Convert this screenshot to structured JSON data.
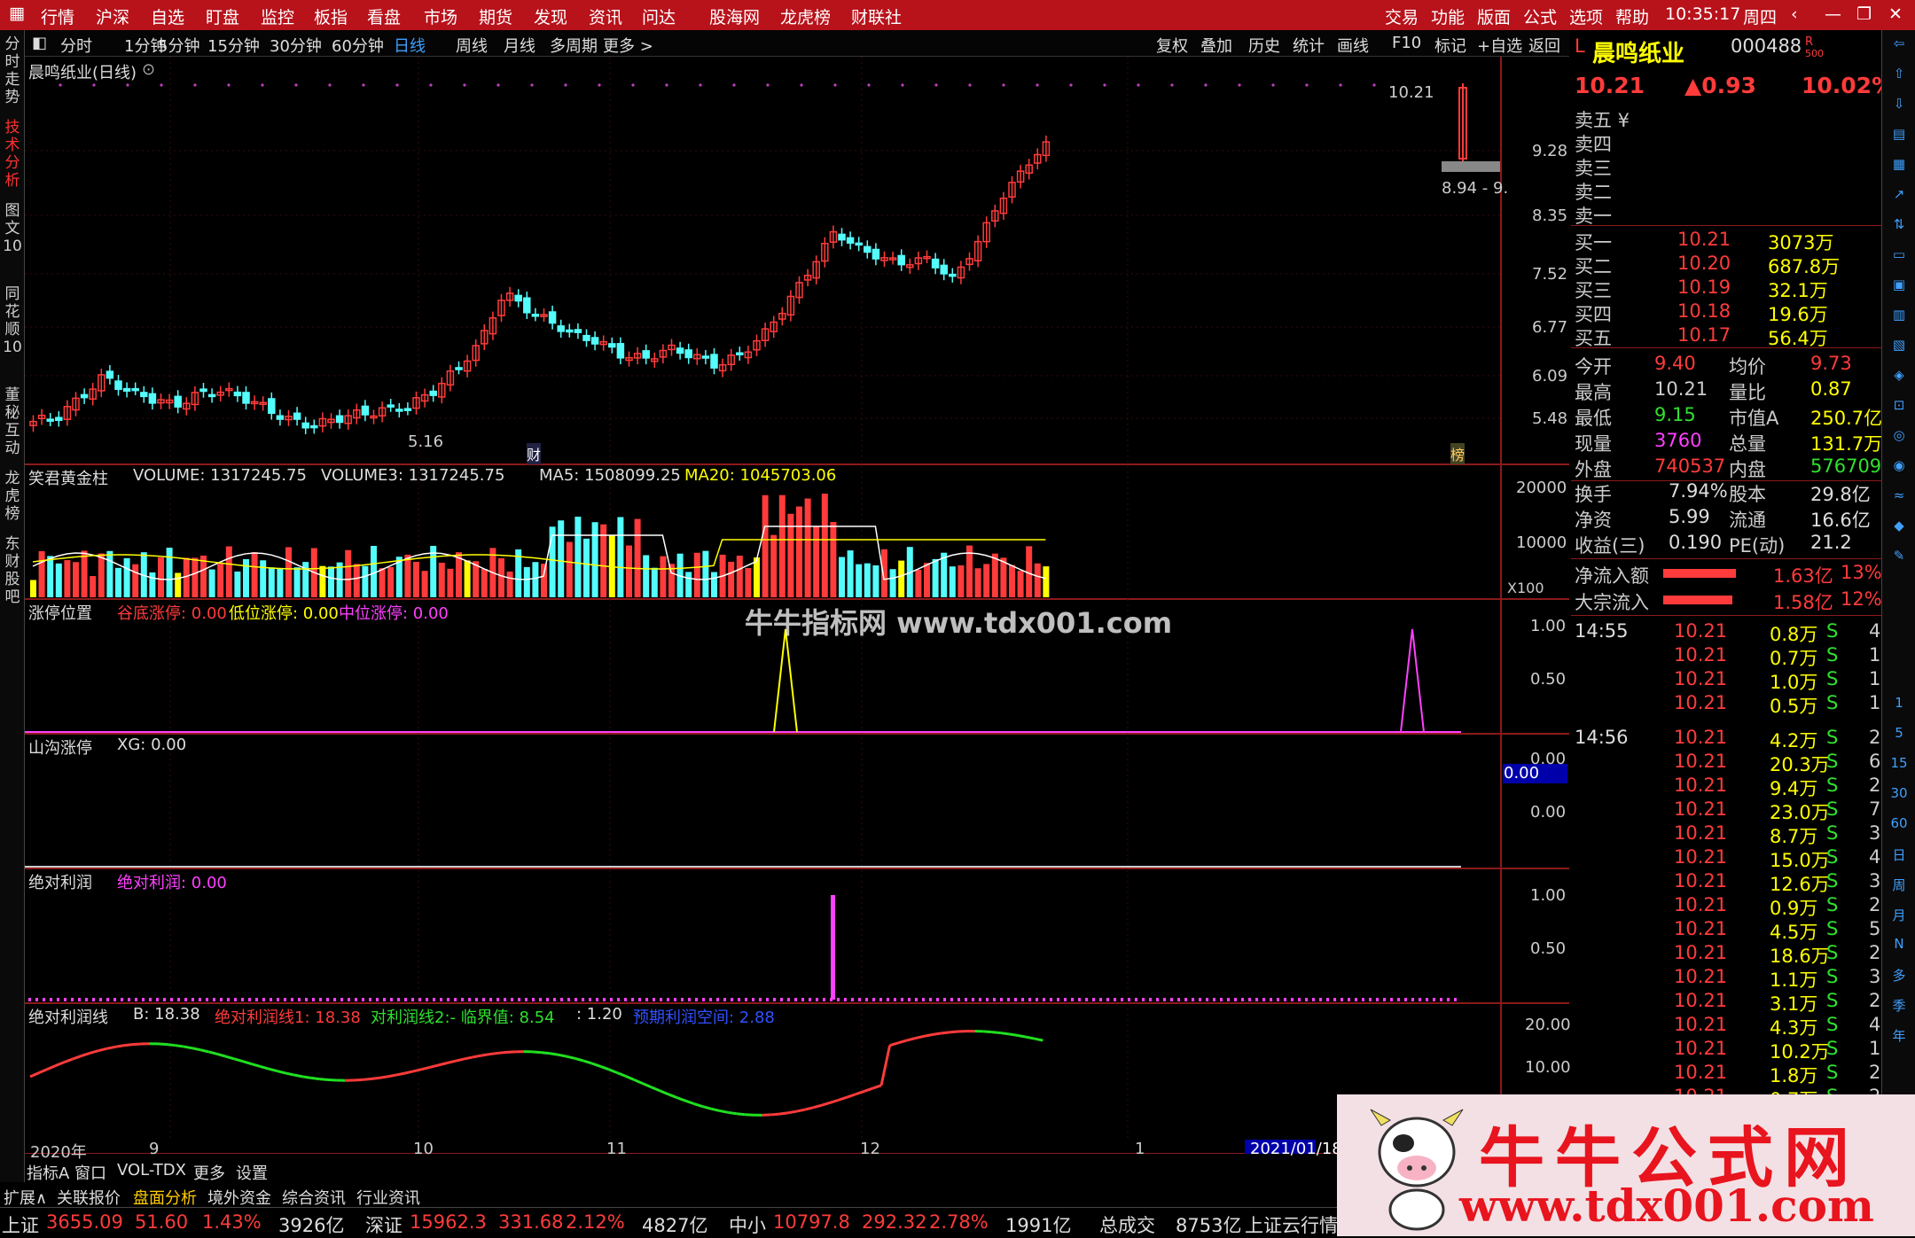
{
  "menu": [
    "行情",
    "沪深",
    "自选",
    "盯盘",
    "监控",
    "板指",
    "看盘",
    "市场",
    "期货",
    "发现",
    "资讯",
    "问达",
    "股海网",
    "龙虎榜",
    "财联社"
  ],
  "menu_right": [
    "交易",
    "功能",
    "版面",
    "公式",
    "选项",
    "帮助"
  ],
  "clock": "10:35:17",
  "weekday": "周四",
  "timeframes": [
    "分时",
    "1分钟",
    "5分钟",
    "15分钟",
    "30分钟",
    "60分钟",
    "日线",
    "周线",
    "月线",
    "多周期",
    "更多 >"
  ],
  "active_timeframe": "日线",
  "tools": [
    "复权",
    "叠加",
    "历史",
    "统计",
    "画线",
    "F10",
    "标记",
    "+自选",
    "返回"
  ],
  "left_tabs": [
    {
      "label": "分时走势",
      "active": false
    },
    {
      "label": "技术分析",
      "active": true
    },
    {
      "label": "图文10",
      "active": false
    },
    {
      "label": "同花顺10",
      "active": false
    },
    {
      "label": "董秘互动",
      "active": false
    },
    {
      "label": "龙虎榜",
      "active": false
    },
    {
      "label": "东财股吧",
      "active": false
    }
  ],
  "stock": {
    "code_prefix": "L",
    "name": "晨鸣纸业",
    "code": "000488",
    "badge": "R",
    "badge2": "500",
    "price": "10.21",
    "change": "▲0.93",
    "pct": "10.02%"
  },
  "chart_title": "晨鸣纸业(日线)",
  "price_axis": [
    "9.28",
    "8.35",
    "7.52",
    "6.77",
    "6.09",
    "5.48"
  ],
  "price_marks": {
    "high": "10.21",
    "low": "5.16",
    "range_tag": "8.94 - 9.",
    "cai": "财",
    "bang": "榜"
  },
  "volume_panel": {
    "name": "笑君黄金柱",
    "vol": "VOLUME: 1317245.75",
    "vol3": "VOLUME3: 1317245.75",
    "ma5": "MA5: 1508099.25",
    "ma20": "MA20: 1045703.06",
    "axis": [
      "20000",
      "10000"
    ],
    "unit": "X100"
  },
  "zt_panel": {
    "name": "涨停位置",
    "a": "谷底涨停: 0.00",
    "b": "低位涨停: 0.00",
    "c": "中位涨停: 0.00",
    "axis": [
      "1.00",
      "0.50"
    ]
  },
  "sg_panel": {
    "name": "山沟涨停",
    "a": "XG: 0.00",
    "axis": [
      "0.00",
      "0.00"
    ],
    "box": "0.00"
  },
  "jd_panel": {
    "name": "绝对利润",
    "a": "绝对利润: 0.00",
    "axis": [
      "1.00",
      "0.50"
    ]
  },
  "jdx_panel": {
    "name": "绝对利润线",
    "a": "B: 18.38",
    "b": "绝对利润线1: 18.38",
    "c": "对利润线2:- 临界值: 8.54",
    "d": ": 1.20",
    "e": "预期利润空间: 2.88",
    "axis": [
      "20.00",
      "10.00"
    ]
  },
  "date_axis": {
    "year": "2020年",
    "m9": "9",
    "m10": "10",
    "m11": "11",
    "m12": "12",
    "m1": "1",
    "cur": "2021/01/18"
  },
  "watermark_mid": "牛牛指标网 www.tdx001.com",
  "watermark_title": "牛牛公式网",
  "watermark_url": "www.tdx001.com",
  "bottom_tabs": [
    "指标A",
    "窗口",
    "VOL-TDX",
    "更多",
    "设置"
  ],
  "bottom_tabs2": [
    "扩展∧",
    "关联报价",
    "盘面分析",
    "境外资金",
    "综合资讯",
    "行业资讯"
  ],
  "asks": [
    "卖五 ¥",
    "卖四",
    "卖三",
    "卖二",
    "卖一"
  ],
  "bids": [
    [
      "买一",
      "10.21",
      "3073万"
    ],
    [
      "买二",
      "10.20",
      "687.8万"
    ],
    [
      "买三",
      "10.19",
      "32.1万"
    ],
    [
      "买四",
      "10.18",
      "19.6万"
    ],
    [
      "买五",
      "10.17",
      "56.4万"
    ]
  ],
  "quote": [
    [
      "今开",
      "9.40",
      "均价",
      "9.73"
    ],
    [
      "最高",
      "10.21",
      "量比",
      "0.87"
    ],
    [
      "最低",
      "9.15",
      "市值A",
      "250.7亿"
    ],
    [
      "现量",
      "3760",
      "总量",
      "131.7万"
    ],
    [
      "外盘",
      "740537",
      "内盘",
      "576709"
    ]
  ],
  "quote2": [
    [
      "换手",
      "7.94%",
      "股本",
      "29.8亿"
    ],
    [
      "净资",
      "5.99",
      "流通",
      "16.6亿"
    ],
    [
      "收益(三)",
      "0.190",
      "PE(动)",
      "21.2"
    ]
  ],
  "flows": [
    [
      "净流入额",
      "1.63亿",
      "13%"
    ],
    [
      "大宗流入",
      "1.58亿",
      "12%"
    ]
  ],
  "ticks": [
    [
      "14:55",
      "10.21",
      "0.8万",
      "S",
      "4"
    ],
    [
      "",
      "10.21",
      "0.7万",
      "S",
      "1"
    ],
    [
      "",
      "10.21",
      "1.0万",
      "S",
      "1"
    ],
    [
      "",
      "10.21",
      "0.5万",
      "S",
      "1"
    ],
    [
      "14:56",
      "10.21",
      "4.2万",
      "S",
      "2"
    ],
    [
      "",
      "10.21",
      "20.3万",
      "S",
      "6"
    ],
    [
      "",
      "10.21",
      "9.4万",
      "S",
      "2"
    ],
    [
      "",
      "10.21",
      "23.0万",
      "S",
      "7"
    ],
    [
      "",
      "10.21",
      "8.7万",
      "S",
      "3"
    ],
    [
      "",
      "10.21",
      "15.0万",
      "S",
      "4"
    ],
    [
      "",
      "10.21",
      "12.6万",
      "S",
      "3"
    ],
    [
      "",
      "10.21",
      "0.9万",
      "S",
      "2"
    ],
    [
      "",
      "10.21",
      "4.5万",
      "S",
      "5"
    ],
    [
      "",
      "10.21",
      "18.6万",
      "S",
      "2"
    ],
    [
      "",
      "10.21",
      "1.1万",
      "S",
      "3"
    ],
    [
      "",
      "10.21",
      "3.1万",
      "S",
      "2"
    ],
    [
      "",
      "10.21",
      "4.3万",
      "S",
      "4"
    ],
    [
      "",
      "10.21",
      "10.2万",
      "S",
      "1"
    ],
    [
      "",
      "10.21",
      "1.8万",
      "S",
      "2"
    ],
    [
      "",
      "10.21",
      "0.7万",
      "S",
      "2"
    ]
  ],
  "right_icons": [
    "1",
    "5",
    "15",
    "30",
    "60",
    "日",
    "周",
    "月",
    "N",
    "多",
    "季",
    "年"
  ],
  "ticker": [
    [
      "上证",
      "3655.09",
      "51.60",
      "1.43%",
      "3926亿"
    ],
    [
      "深证",
      "15962.3",
      "331.68",
      "2.12%",
      "4827亿"
    ],
    [
      "中小",
      "10797.8",
      "292.32",
      "2.78%",
      "1991亿"
    ]
  ],
  "ticker_total": "总成交",
  "ticker_total_val": "8753亿",
  "ticker_note": "上证云行情A",
  "colors": {
    "up": "#ff3b3b",
    "down": "#54fcfc",
    "accent": "#b8121b",
    "yellow": "#ffff00",
    "magenta": "#ff40ff"
  }
}
